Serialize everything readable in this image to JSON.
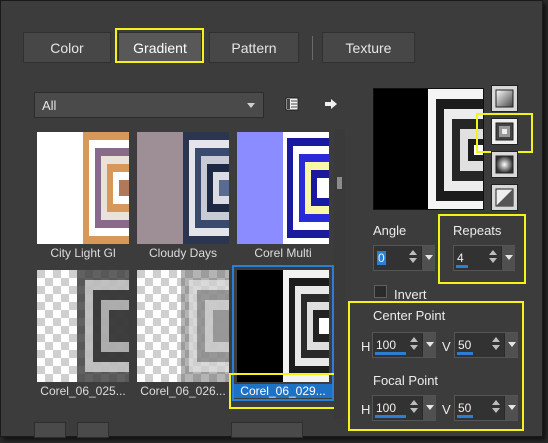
{
  "tabs": [
    {
      "label": "Color"
    },
    {
      "label": "Gradient"
    },
    {
      "label": "Pattern"
    },
    {
      "label": "Texture"
    }
  ],
  "category_select": {
    "value": "All"
  },
  "thumbnails": [
    {
      "label": "City Light Gl"
    },
    {
      "label": "Cloudy Days"
    },
    {
      "label": "Corel Multi"
    },
    {
      "label": "Corel_06_025..."
    },
    {
      "label": "Corel_06_026..."
    },
    {
      "label": "Corel_06_029..."
    }
  ],
  "angle": {
    "label": "Angle",
    "value": "0"
  },
  "repeats": {
    "label": "Repeats",
    "value": "4"
  },
  "invert": {
    "label": "Invert",
    "checked": false
  },
  "center_point": {
    "label": "Center Point",
    "h_label": "H",
    "h_value": "100",
    "v_label": "V",
    "v_value": "50"
  },
  "focal_point": {
    "label": "Focal Point",
    "h_label": "H",
    "h_value": "100",
    "v_label": "V",
    "v_value": "50"
  },
  "colors": {
    "highlight": "#f3f31a",
    "selection": "#1e72c6",
    "background": "#3c3c3c"
  },
  "icons": [
    "chevron-down-icon",
    "library-icon",
    "arrow-right-icon",
    "linear-style-icon",
    "rectangular-style-icon",
    "sunburst-style-icon",
    "radial-style-icon"
  ]
}
